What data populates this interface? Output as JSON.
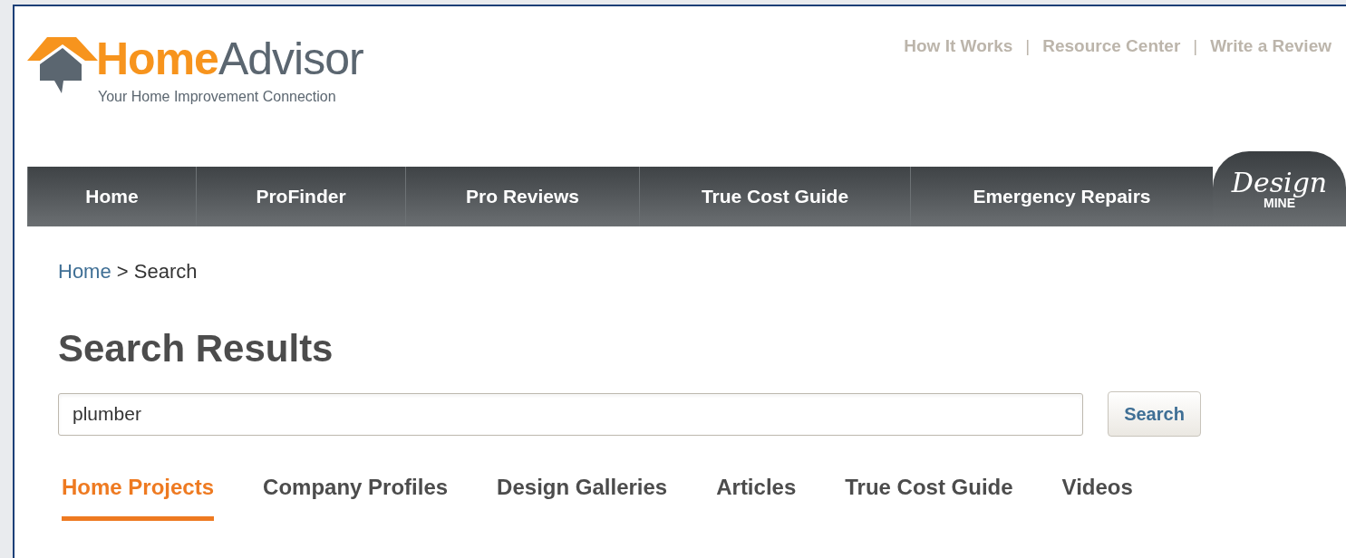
{
  "logo": {
    "brand_first": "Home",
    "brand_second": "Advisor",
    "tagline": "Your Home Improvement Connection"
  },
  "top_links": [
    "How It Works",
    "Resource Center",
    "Write a Review"
  ],
  "top_link_separator": "|",
  "nav": [
    {
      "label": "Home",
      "kind": "item"
    },
    {
      "label": "ProFinder",
      "kind": "item"
    },
    {
      "label": "Pro Reviews",
      "kind": "item"
    },
    {
      "label": "True Cost Guide",
      "kind": "item"
    },
    {
      "label": "Emergency Repairs",
      "kind": "item"
    },
    {
      "label": "Design",
      "sub": "MINE",
      "kind": "logo"
    }
  ],
  "breadcrumb": {
    "link": "Home",
    "separator": ">",
    "current": "Search"
  },
  "heading": "Search Results",
  "search": {
    "value": "plumber",
    "button": "Search"
  },
  "tabs": [
    {
      "label": "Home Projects",
      "selected": true
    },
    {
      "label": "Company Profiles",
      "selected": false
    },
    {
      "label": "Design Galleries",
      "selected": false
    },
    {
      "label": "Articles",
      "selected": false
    },
    {
      "label": "True Cost Guide",
      "selected": false
    },
    {
      "label": "Videos",
      "selected": false
    }
  ]
}
